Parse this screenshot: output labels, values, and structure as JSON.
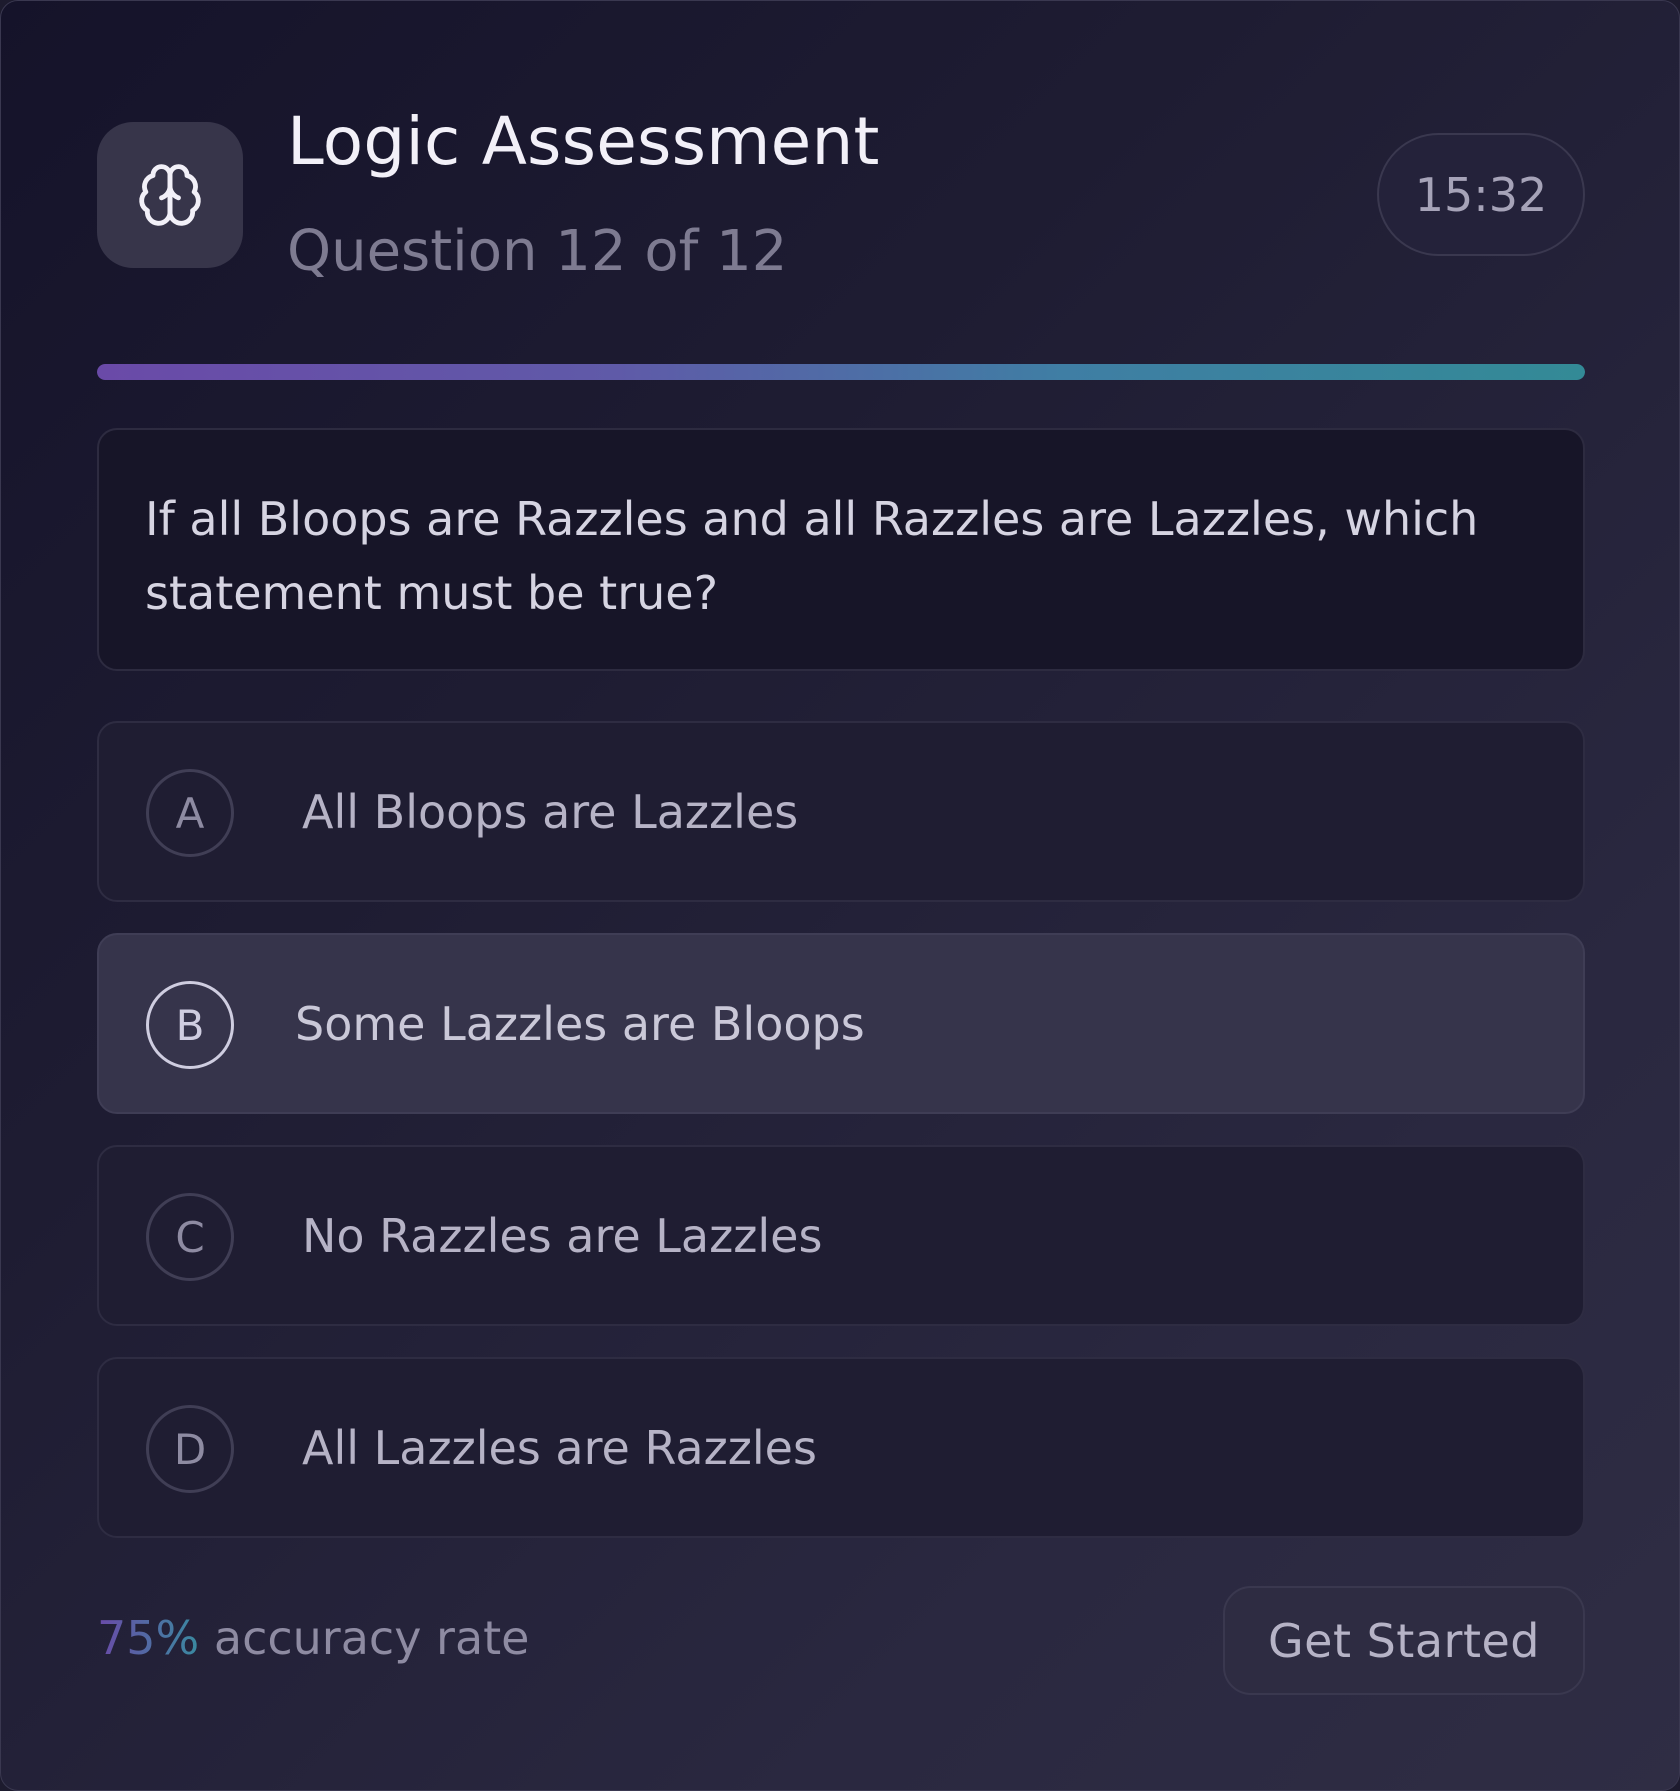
{
  "header": {
    "logo_icon": "brain-icon",
    "title": "Logic Assessment",
    "subtitle": "Question 12 of 12",
    "timer": "15:32"
  },
  "progress": {
    "fraction": 1.0
  },
  "question": {
    "text": "If all Bloops are Razzles and all Razzles are Lazzles, which statement must be true?"
  },
  "options": [
    {
      "letter": "A",
      "text": "All Bloops are Lazzles",
      "selected": false
    },
    {
      "letter": "B",
      "text": "Some Lazzles are Bloops",
      "selected": true
    },
    {
      "letter": "C",
      "text": "No Razzles are Lazzles",
      "selected": false
    },
    {
      "letter": "D",
      "text": "All Lazzles are Razzles",
      "selected": false
    }
  ],
  "footer": {
    "accuracy_value": "75%",
    "accuracy_label": "accuracy rate",
    "cta_label": "Get Started"
  },
  "colors": {
    "accent_purple": "#6a4aa8",
    "accent_teal": "#338a96",
    "background": "#1d1b2e"
  }
}
